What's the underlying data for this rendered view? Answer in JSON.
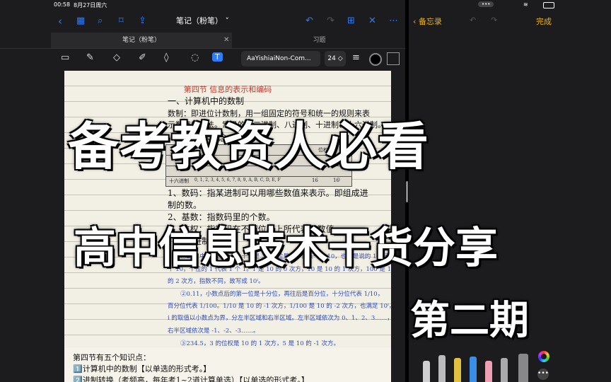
{
  "status": {
    "time": "00:58",
    "date": "8月27日周六"
  },
  "notes_app": {
    "doc_title": "笔记（粉笔）",
    "tabs": [
      {
        "label": "笔记（粉笔）"
      },
      {
        "label": "习题"
      }
    ],
    "font_name": "AaYishiaiNon-Com...",
    "font_size": "24 ◇"
  },
  "page": {
    "heading": "第四节 信息的表示和编码",
    "lines": [
      "一、计算机中的数制",
      "数制：即进位计数制，用一组固定的符号和统一的规则来表",
      "示数值的方法。常见的有二进制、八进制、十进制、十六进制。",
      "（一）基本概念",
      "1、数码：指某进制可以用哪些数值来表示。即组成进",
      "制的数。",
      "2、基数：指数码里的个数。",
      "3、位权：指数码在不同位置上所代表的数值。",
      "（二）进制的转换"
    ],
    "table_text": {
      "header": "位权",
      "row_label": "十六进制",
      "row_values": "0, 1, 2, 3, 4, 5, 6, 7, 8, 9, A, B, C, D, E, F",
      "row_base": "16",
      "row_weight": "16ⁱ"
    },
    "blue_lines": [
      "①234 中的个位是 4，十位是 3，百位是 2，代表一个 10，也就是说的 1 代表 1",
      "个 10，个位的 1 代表 1 个 1。1 是 10 的 0 次方，10 是 10 的 1 次方，100 是 10",
      "的 2 次方，指数不同，故写成 10ⁱ。",
      "②0.11，小数点后的第一位是十分位，再往后是百分位，十分位代表 1/10，",
      "百分位代表 1/100。1/10 是 10 的 -1 次方，1/100 是 10 的 -2 次方，也满足 10ⁱ，",
      "i 的取值以小数点为界，分左半区域和右半区域。左半区域依次为 0、1、2、3……，",
      "右半区域依次是 -1、-2、-3……。",
      "③234.5，3 的位权是 10 的 1 次方，5 是 10 的 -1 次方。"
    ],
    "bottom_lines": [
      "第四节有五个知识点：",
      "1️⃣计算机中的数制【以单选的形式考。】",
      "2️⃣进制转换（考频高，每年考1~2道计算单选）【以单选的形式考。】"
    ]
  },
  "memo_app": {
    "back_label": "备忘录",
    "done_label": "完成",
    "more": "•••"
  },
  "overlay": {
    "line1": "备考教资人必看",
    "line2": "高中信息技术干货分享",
    "line3": "第二期"
  },
  "colors": {
    "accent_blue": "#2f7cf6",
    "memo_yellow": "#f0b400",
    "heading_red": "#c0392b",
    "note_blue": "#2f4cc0"
  }
}
